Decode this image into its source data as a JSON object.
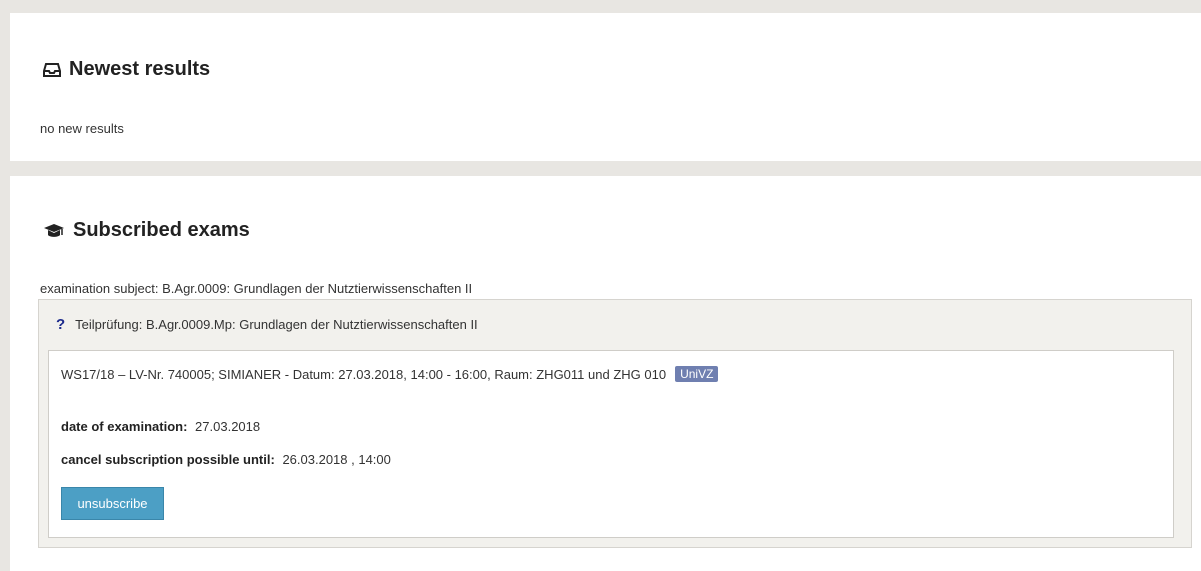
{
  "newest_results": {
    "title": "Newest results",
    "icon": "inbox-icon",
    "empty_text": "no new results"
  },
  "subscribed_exams": {
    "title": "Subscribed exams",
    "icon": "graduation-cap-icon",
    "subject_label": "examination subject: B.Agr.0009: Grundlagen der Nutztierwissenschaften II",
    "part": {
      "icon": "question-icon",
      "label": "Teilprüfung: B.Agr.0009.Mp: Grundlagen der Nutztierwissenschaften II",
      "session": {
        "info": "WS17/18 – LV-Nr. 740005; SIMIANER - Datum: 27.03.2018, 14:00 - 16:00, Raum: ZHG011 und ZHG 010",
        "badge": "UniVZ",
        "date_label": "date of examination:",
        "date_value": "27.03.2018",
        "cancel_label": "cancel subscription possible until:",
        "cancel_value": "26.03.2018 , 14:00",
        "button_label": "unsubscribe"
      }
    }
  },
  "colors": {
    "page_bg": "#e8e6e2",
    "button_bg": "#4c9fc5",
    "badge_bg": "#6f7fb0",
    "question_icon": "#1c2a8c"
  }
}
